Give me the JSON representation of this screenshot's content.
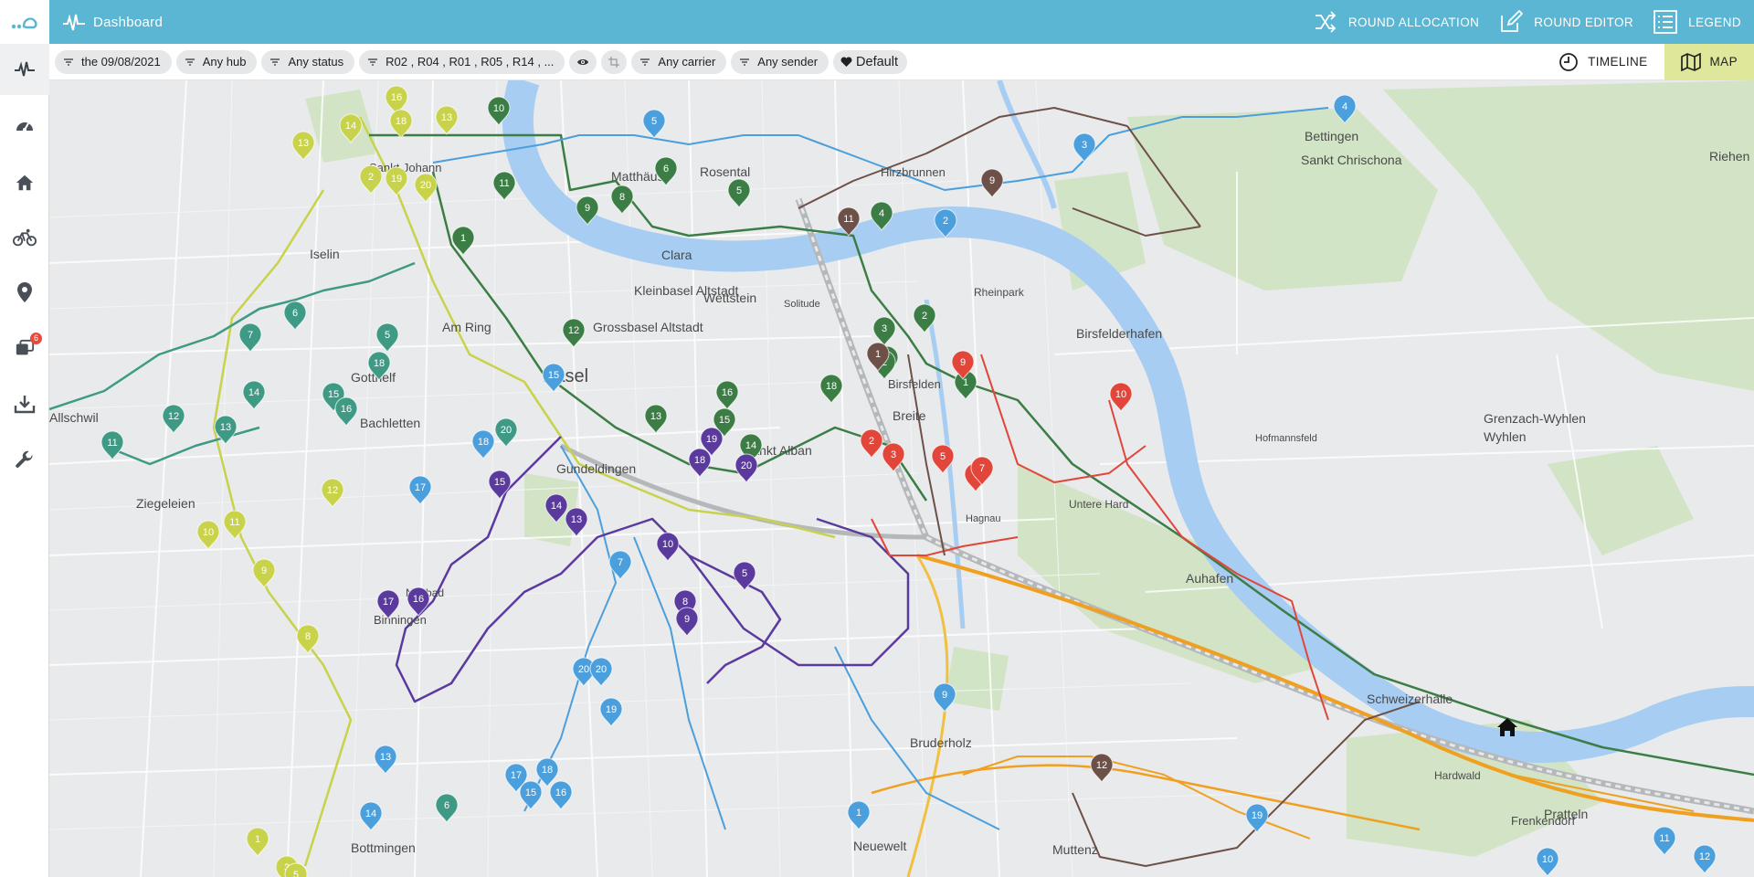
{
  "header": {
    "brand": "Dashboard",
    "nav": [
      {
        "label": "ROUND ALLOCATION",
        "icon": "shuffle-icon"
      },
      {
        "label": "ROUND EDITOR",
        "icon": "edit-icon"
      },
      {
        "label": "LEGEND",
        "icon": "list-icon"
      }
    ]
  },
  "sidebar": {
    "items": [
      {
        "name": "activity",
        "icon": "pulse-icon",
        "active": true
      },
      {
        "name": "speed",
        "icon": "speedometer-icon"
      },
      {
        "name": "hubs",
        "icon": "home-icon"
      },
      {
        "name": "carriers",
        "icon": "bicycle-icon"
      },
      {
        "name": "locations",
        "icon": "map-pin-icon"
      },
      {
        "name": "messages",
        "icon": "chat-icon",
        "badge": "6"
      },
      {
        "name": "import",
        "icon": "download-icon"
      },
      {
        "name": "settings",
        "icon": "wrench-icon"
      }
    ]
  },
  "filters": {
    "date": "the 09/08/2021",
    "hub": "Any hub",
    "status": "Any status",
    "rounds": "R02 , R04 , R01 , R05 , R14 , ...",
    "carrier": "Any carrier",
    "sender": "Any sender",
    "preset": "Default"
  },
  "view_toggle": {
    "timeline": "TIMELINE",
    "map": "MAP",
    "active": "map"
  },
  "colors": {
    "header": "#5ab6d3",
    "map_toggle_active": "#dfe79a",
    "water": "#a7cdf2",
    "round_yellow": "#c8d24a",
    "round_green": "#3c7d46",
    "round_teal": "#3f9a85",
    "round_blue": "#4a9fdc",
    "round_purple": "#5b3a9e",
    "round_red": "#e2453a",
    "round_brown": "#6d5148",
    "round_orange": "#f0a020"
  },
  "map": {
    "place_labels": [
      "Matthäus",
      "Rosental",
      "Hirzbrunnen",
      "Clara",
      "Kleinbasel Altstadt",
      "Wettstein",
      "Grossbasel Altstadt",
      "Am Ring",
      "Basel",
      "Gotthelf",
      "Bachletten",
      "Gundeldingen",
      "Sankt Alban",
      "Breite",
      "Birsfelderhafen",
      "Bruderholz",
      "Bottmingen",
      "Neuewelt",
      "Muttenz",
      "Schweizerhalle",
      "Auhafen",
      "Hardwald",
      "Frenkendorf",
      "Pratteln",
      "Wyhlen",
      "Grenzach-Wyhlen",
      "Bettingen",
      "Sankt Chrischona",
      "Riehen",
      "Birsfelden",
      "Iselin",
      "Allschwil",
      "Ziegeleien",
      "Binningen",
      "Neubad",
      "Sankt Johann",
      "Rheinpark",
      "Solitude",
      "Hagnau",
      "Untere Hard",
      "Hofmannsfeld"
    ],
    "pins": {
      "yellow": [
        "16",
        "13",
        "14",
        "18",
        "13",
        "19",
        "2",
        "20",
        "12",
        "10",
        "11",
        "9",
        "8",
        "1",
        "3",
        "5"
      ],
      "green": [
        "10",
        "11",
        "9",
        "8",
        "6",
        "5",
        "4",
        "1",
        "3",
        "2",
        "12",
        "13",
        "16",
        "15",
        "14",
        "18",
        "2",
        "3",
        "1"
      ],
      "teal": [
        "7",
        "6",
        "12",
        "13",
        "14",
        "11",
        "15",
        "16",
        "18",
        "5",
        "20",
        "6"
      ],
      "blue": [
        "5",
        "3",
        "4",
        "2",
        "15",
        "18",
        "17",
        "7",
        "20",
        "20",
        "19",
        "9",
        "17",
        "18",
        "16",
        "15",
        "1",
        "14",
        "13",
        "19",
        "11",
        "10",
        "12"
      ],
      "purple": [
        "19",
        "18",
        "20",
        "15",
        "14",
        "13",
        "10",
        "5",
        "17",
        "16",
        "8",
        "9"
      ],
      "red": [
        "9",
        "10",
        "2",
        "3",
        "5",
        "7",
        "7"
      ],
      "brown": [
        "9",
        "11",
        "1",
        "12"
      ]
    }
  }
}
